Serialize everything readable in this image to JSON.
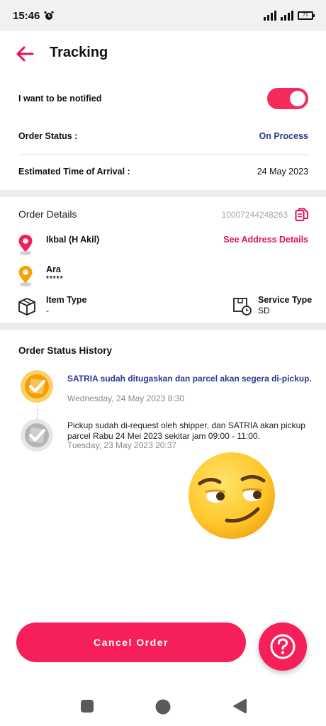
{
  "status_bar": {
    "time": "15:46",
    "battery": "71"
  },
  "header": {
    "title": "Tracking"
  },
  "notify": {
    "label": "I want to be notified",
    "enabled": true
  },
  "order_status": {
    "label": "Order Status :",
    "value": "On Process"
  },
  "eta": {
    "label": "Estimated Time of Arrival :",
    "value": "24 May 2023"
  },
  "order_details": {
    "title": "Order Details",
    "number": "10007244248263",
    "sender": {
      "name": "Ikbal (H Akil)"
    },
    "see_address": "See Address Details",
    "receiver": {
      "name": "Ara",
      "sub": "*****"
    },
    "item_type": {
      "label": "Item Type",
      "value": "-"
    },
    "service_type": {
      "label": "Service Type",
      "value": "SD"
    }
  },
  "history": {
    "title": "Order Status History",
    "items": [
      {
        "text": "SATRIA sudah ditugaskan dan parcel akan segera di-pickup.",
        "date": "Wednesday, 24 May 2023 8:30"
      },
      {
        "text": "Pickup sudah di-request oleh shipper, dan SATRIA akan pickup parcel Rabu 24 Mei 2023 sekitar jam 09:00 - 11:00.",
        "date": "Tuesday, 23 May 2023 20:37"
      }
    ]
  },
  "actions": {
    "cancel_label": "Cancel Order"
  },
  "colors": {
    "accent": "#f71f5a",
    "status_blue": "#2b3a8f",
    "orange": "#f4a300"
  }
}
